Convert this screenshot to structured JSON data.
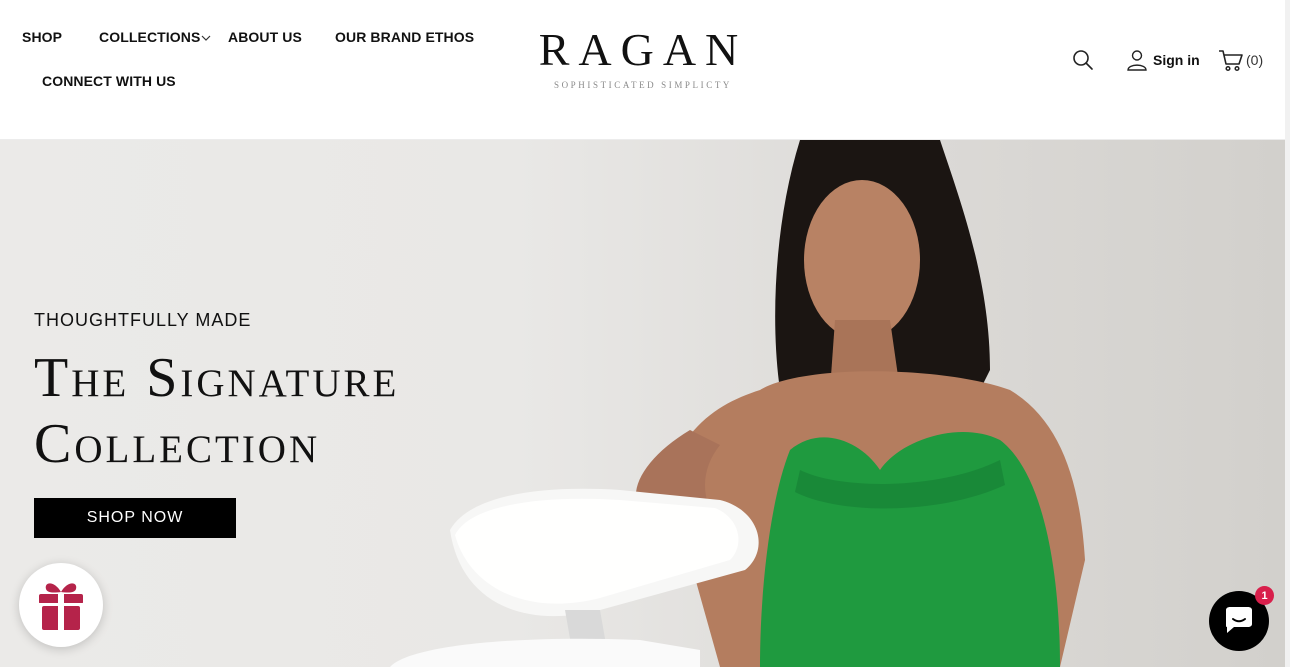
{
  "nav": {
    "items": [
      {
        "label": "SHOP"
      },
      {
        "label": "COLLECTIONS"
      },
      {
        "label": "ABOUT US"
      },
      {
        "label": "OUR BRAND ETHOS"
      },
      {
        "label": "CONNECT WITH US"
      }
    ]
  },
  "logo": {
    "wordmark": "RAGAN",
    "tagline": "SOPHISTICATED SIMPLICTY"
  },
  "account": {
    "sign_in": "Sign in",
    "cart_count": "(0)"
  },
  "hero": {
    "eyebrow": "THOUGHTFULLY MADE",
    "title": "The Signature Collection",
    "button": "SHOP NOW",
    "dress_color": "#1f9a3f"
  },
  "chat": {
    "badge": "1"
  },
  "icons": [
    "chevron-down-icon",
    "search-icon",
    "user-icon",
    "cart-icon",
    "gift-icon",
    "chat-icon"
  ],
  "colors": {
    "gift": "#b5234a",
    "badge": "#d81f4b",
    "button": "#000000"
  }
}
